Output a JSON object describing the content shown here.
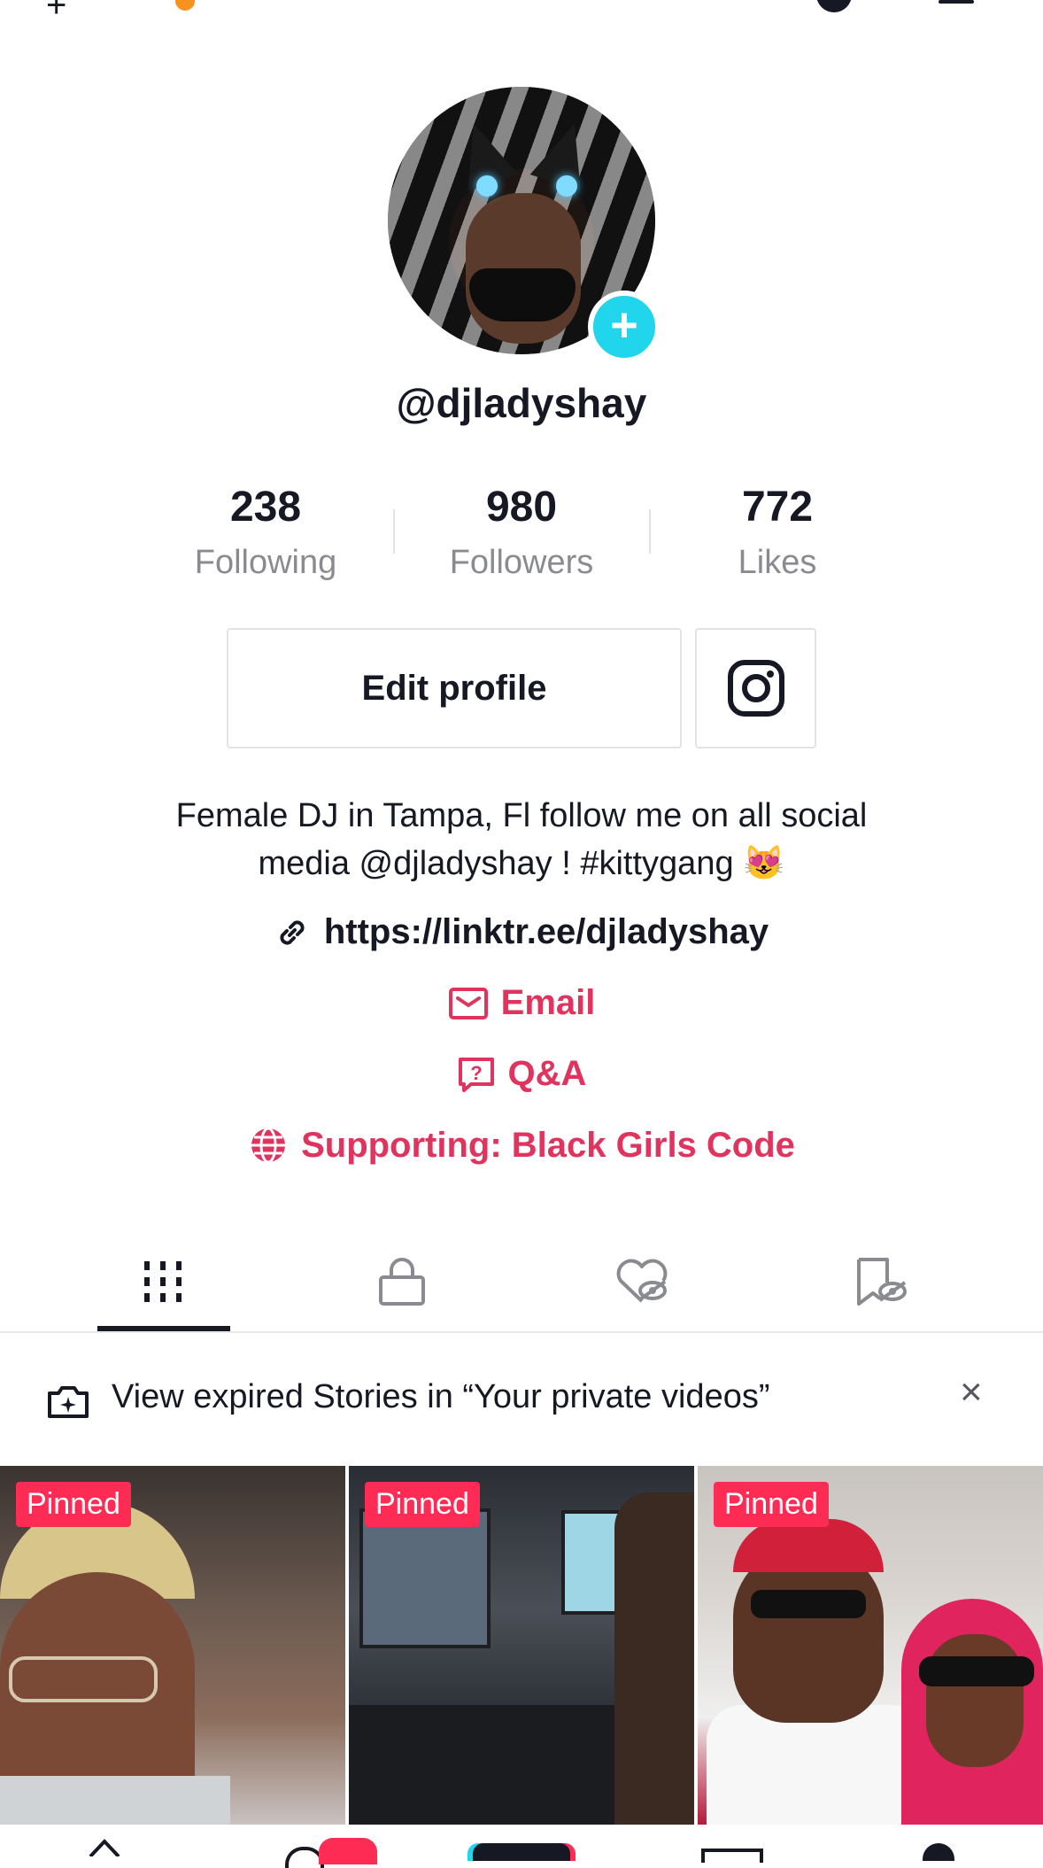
{
  "profile": {
    "username": "@djladyshay",
    "add_badge": "+",
    "stats": [
      {
        "value": "238",
        "label": "Following"
      },
      {
        "value": "980",
        "label": "Followers"
      },
      {
        "value": "772",
        "label": "Likes"
      }
    ],
    "edit_button_label": "Edit profile",
    "instagram_icon": "instagram-icon",
    "bio_line1": "Female DJ in Tampa, Fl follow me on all social",
    "bio_line2": "media @djladyshay ! #kittygang",
    "bio_emoji": "😻",
    "link": "https://linktr.ee/djladyshay",
    "email_label": "Email",
    "qa_label": "Q&A",
    "supporting_label": "Supporting: Black Girls Code"
  },
  "tabs": [
    {
      "name": "videos",
      "icon": "grid-icon",
      "active": true
    },
    {
      "name": "private",
      "icon": "lock-icon",
      "active": false
    },
    {
      "name": "liked",
      "icon": "heart-hidden-icon",
      "active": false
    },
    {
      "name": "favorites",
      "icon": "bookmark-hidden-icon",
      "active": false
    }
  ],
  "notice": {
    "text": "View expired Stories in “Your private videos”",
    "close": "×"
  },
  "videos": [
    {
      "badge": "Pinned"
    },
    {
      "badge": "Pinned"
    },
    {
      "badge": "Pinned"
    }
  ],
  "colors": {
    "accent_pink": "#e0335e",
    "pinned_badge": "#fe2c55",
    "add_badge": "#20d5ec",
    "text_primary": "#161823",
    "text_secondary": "#8a8b91"
  }
}
